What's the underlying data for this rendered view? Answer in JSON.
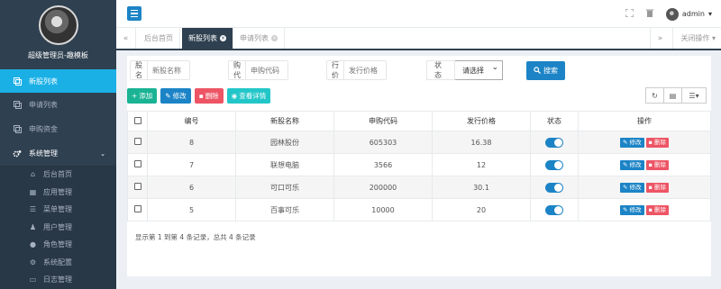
{
  "sidebar": {
    "username": "超级管理员-趣模板",
    "items": [
      {
        "label": "新股列表",
        "icon": "list-icon",
        "active": true
      },
      {
        "label": "申请列表",
        "icon": "list-icon",
        "active": false
      },
      {
        "label": "申购资金",
        "icon": "list-icon",
        "active": false
      }
    ],
    "system": {
      "label": "系统管理",
      "icon": "gears-icon"
    },
    "sub_items": [
      {
        "label": "后台首页",
        "icon": "home-icon"
      },
      {
        "label": "应用管理",
        "icon": "grid-icon"
      },
      {
        "label": "菜单管理",
        "icon": "menu-icon"
      },
      {
        "label": "用户管理",
        "icon": "user-icon"
      },
      {
        "label": "角色管理",
        "icon": "role-icon"
      },
      {
        "label": "系统配置",
        "icon": "gear-icon"
      },
      {
        "label": "日志管理",
        "icon": "log-icon"
      }
    ]
  },
  "topbar": {
    "user": "admin"
  },
  "tabs": {
    "items": [
      {
        "label": "后台首页"
      },
      {
        "label": "新股列表"
      },
      {
        "label": "申请列表"
      }
    ],
    "close_ops": "关闭操作"
  },
  "search": {
    "name_label": "新股名称",
    "name_placeholder": "新股名称",
    "code_label": "申购代码",
    "code_placeholder": "申购代码",
    "price_label": "发行价格",
    "price_placeholder": "发行价格",
    "status_label": "状态",
    "status_value": "请选择",
    "search_button": "搜索"
  },
  "toolbar": {
    "add": "添加",
    "edit": "修改",
    "delete": "删除",
    "detail": "查看详情"
  },
  "table": {
    "headers": [
      "编号",
      "新股名称",
      "申购代码",
      "发行价格",
      "状态",
      "操作"
    ],
    "rows": [
      {
        "id": "8",
        "name": "园林股份",
        "code": "605303",
        "price": "16.38"
      },
      {
        "id": "7",
        "name": "联想电脑",
        "code": "3566",
        "price": "12"
      },
      {
        "id": "6",
        "name": "可口可乐",
        "code": "200000",
        "price": "30.1"
      },
      {
        "id": "5",
        "name": "百事可乐",
        "code": "10000",
        "price": "20"
      }
    ],
    "row_edit": "修改",
    "row_delete": "删除"
  },
  "footer": "显示第 1 到第 4 条记录，总共 4 条记录",
  "colors": {
    "accent": "#1c84c6",
    "sidebar": "#2f4050",
    "active": "#1ab0e6",
    "danger": "#ed5565",
    "success": "#1ab394",
    "info": "#23c6c8"
  }
}
